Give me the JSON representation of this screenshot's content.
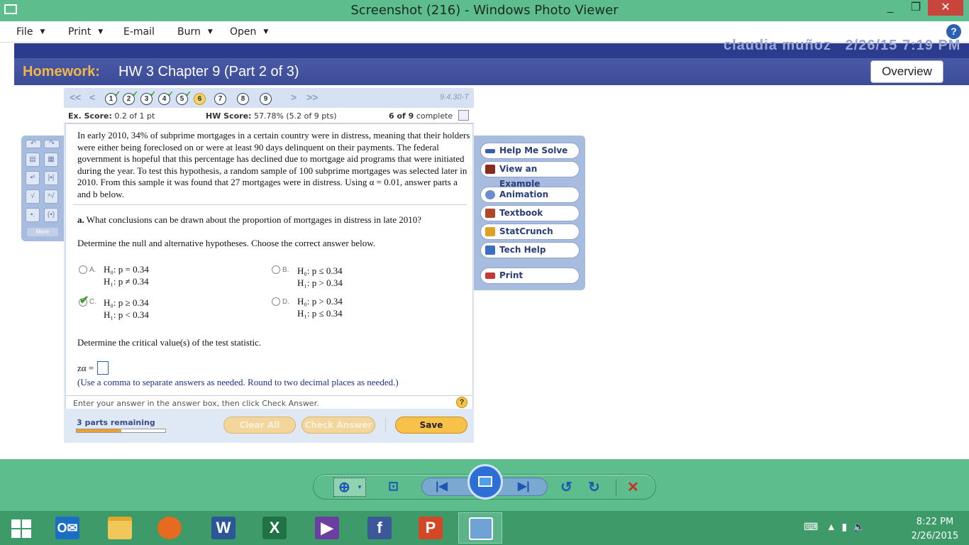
{
  "window": {
    "title": "Screenshot (216) - Windows Photo Viewer",
    "minimize": "_",
    "maximize": "❐",
    "close": "✕"
  },
  "menu": {
    "file": "File",
    "print": "Print",
    "email": "E-mail",
    "burn": "Burn",
    "open": "Open",
    "help": "?"
  },
  "header": {
    "user_partial": "claudia muñoz",
    "date_partial": "2/26/15 7:19 PM",
    "label": "Homework:",
    "title": "HW 3 Chapter 9 (Part 2 of 3)",
    "overview": "Overview"
  },
  "qnav": {
    "first": "<<",
    "prev": "<",
    "next": ">",
    "last": ">>",
    "question_id": "9.4.30-T",
    "questions": [
      {
        "n": "1",
        "state": "done"
      },
      {
        "n": "2",
        "state": "done"
      },
      {
        "n": "3",
        "state": "done"
      },
      {
        "n": "4",
        "state": "done"
      },
      {
        "n": "5",
        "state": "done"
      },
      {
        "n": "6",
        "state": "current"
      },
      {
        "n": "7",
        "state": "todo"
      },
      {
        "n": "8",
        "state": "todo"
      },
      {
        "n": "9",
        "state": "todo"
      }
    ]
  },
  "score": {
    "ex_label": "Ex. Score:",
    "ex_value": "0.2 of 1 pt",
    "hw_label": "HW Score:",
    "hw_value": "57.78% (5.2 of 9 pts)",
    "progress_bold": "6 of 9",
    "progress_rest": "complete"
  },
  "question": {
    "intro": "In early 2010, 34% of subprime mortgages in a certain country were in distress, meaning that their holders were either being foreclosed on or were at least 90 days delinquent on their payments. The federal government is hopeful that this percentage has declined due to mortgage aid programs that were initiated during the year. To test this hypothesis, a random sample of 100 subprime mortgages was selected later in 2010. From this sample it was found that 27 mortgages were in distress. Using α = 0.01, answer parts a and b below.",
    "part_a_label": "a.",
    "part_a": "What conclusions can be drawn about the proportion of mortgages in distress in late 2010?",
    "determine_hyp": "Determine the null and alternative hypotheses. Choose the correct answer below.",
    "options": [
      {
        "letter": "A.",
        "h0": "H₀: p = 0.34",
        "h1": "H₁: p ≠ 0.34",
        "selected": false
      },
      {
        "letter": "B.",
        "h0": "H₀: p ≤ 0.34",
        "h1": "H₁: p > 0.34",
        "selected": false
      },
      {
        "letter": "C.",
        "h0": "H₀: p ≥ 0.34",
        "h1": "H₁: p < 0.34",
        "selected": true
      },
      {
        "letter": "D.",
        "h0": "H₀: p > 0.34",
        "h1": "H₁: p ≤ 0.34",
        "selected": false
      }
    ],
    "determine_crit": "Determine the critical value(s) of the test statistic.",
    "z_label": "zα =",
    "z_value": "",
    "note": "(Use a comma to separate answers as needed. Round to two decimal places as needed.)",
    "hint": "Enter your answer in the answer box, then click Check Answer.",
    "hint_icon": "?"
  },
  "bottom": {
    "parts_remaining": "3 parts remaining",
    "progress_fraction": 0.5,
    "clear_all": "Clear All",
    "check_answer": "Check Answer",
    "save": "Save"
  },
  "tools": {
    "more": "More"
  },
  "side": {
    "help_me": "Help Me Solve This",
    "example": "View an Example",
    "animation": "Animation",
    "textbook": "Textbook",
    "statcrunch": "StatCrunch",
    "techhelp": "Tech Help",
    "print": "Print"
  },
  "taskbar": {
    "time": "8:22 PM",
    "date": "2/26/2015"
  }
}
